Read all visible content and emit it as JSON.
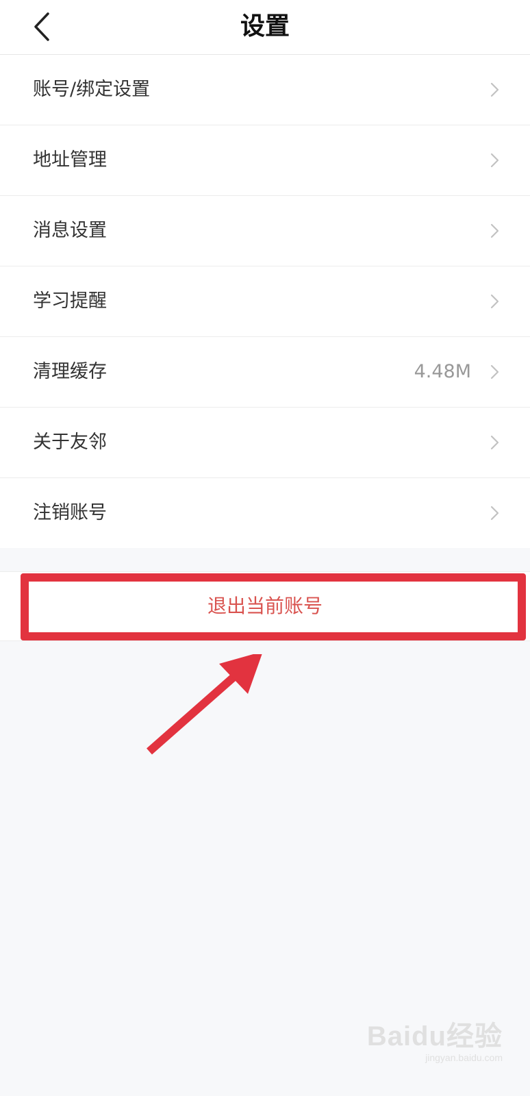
{
  "header": {
    "title": "设置",
    "back_icon": "chevron-left-icon"
  },
  "menu": {
    "items": [
      {
        "label": "账号/绑定设置",
        "value": ""
      },
      {
        "label": "地址管理",
        "value": ""
      },
      {
        "label": "消息设置",
        "value": ""
      },
      {
        "label": "学习提醒",
        "value": ""
      },
      {
        "label": "清理缓存",
        "value": "4.48M"
      },
      {
        "label": "关于友邻",
        "value": ""
      },
      {
        "label": "注销账号",
        "value": ""
      }
    ],
    "chevron_icon": "chevron-right-icon"
  },
  "logout": {
    "label": "退出当前账号"
  },
  "annotation": {
    "highlight_color": "#e2333f",
    "arrow_icon": "arrow-up-right-icon"
  },
  "watermark": {
    "logo": "Baidu经验",
    "url": "jingyan.baidu.com"
  },
  "colors": {
    "background": "#f7f8fa",
    "surface": "#ffffff",
    "logout_text": "#d9534f",
    "secondary_text": "#999999"
  }
}
